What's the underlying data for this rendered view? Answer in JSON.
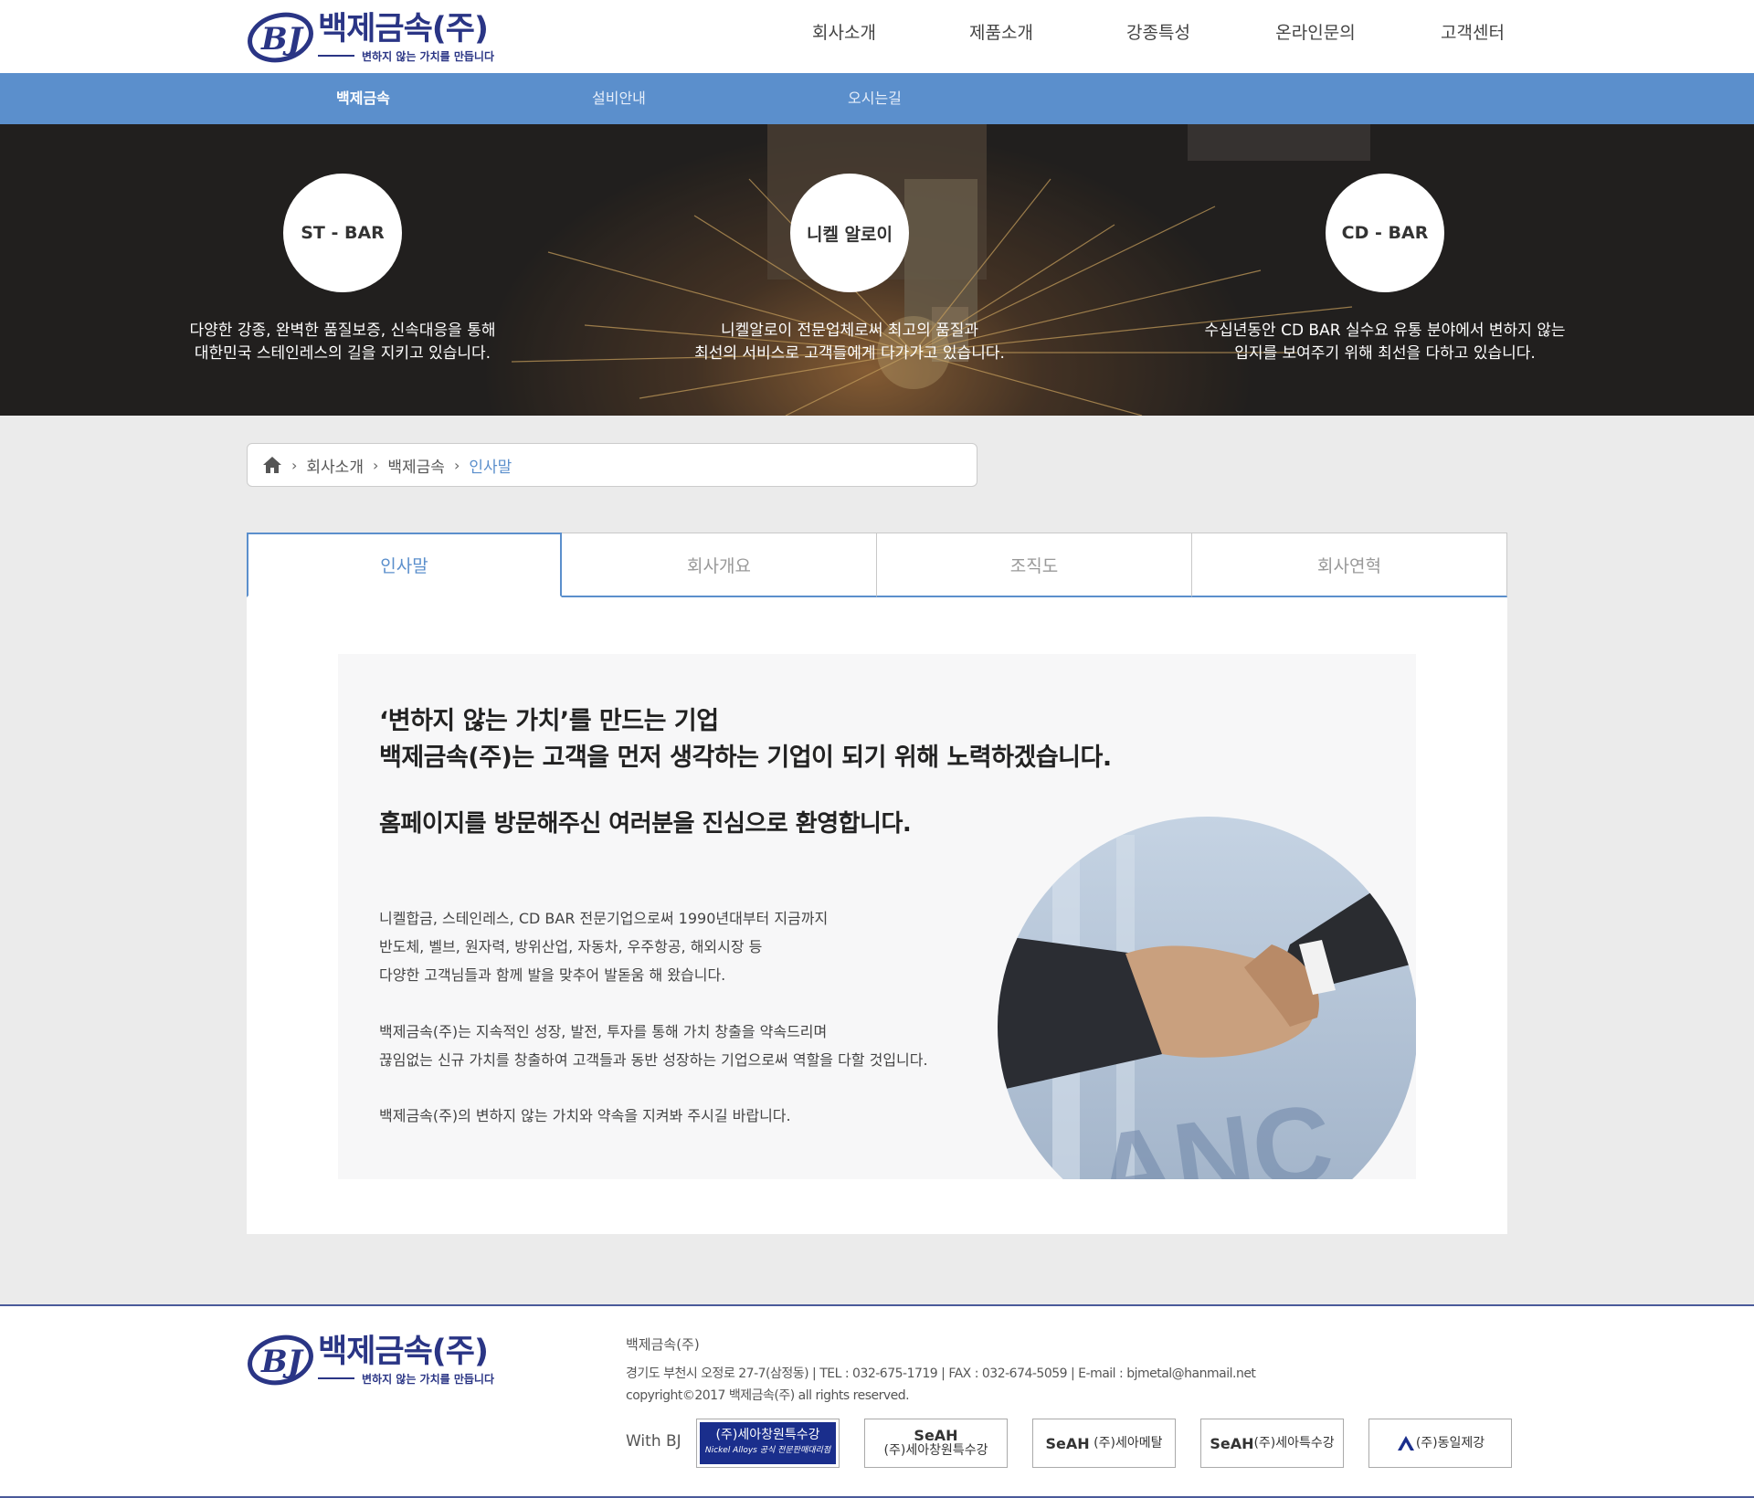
{
  "header": {
    "company_name": "백제금속(주)",
    "slogan": "변하지 않는 가치를 만듭니다",
    "nav": [
      "회사소개",
      "제품소개",
      "강종특성",
      "온라인문의",
      "고객센터"
    ]
  },
  "subnav": [
    "백제금속",
    "설비안내",
    "오시는길"
  ],
  "hero": [
    {
      "title": "ST - BAR",
      "line1": "다양한 강종, 완벽한 품질보증, 신속대응을 통해",
      "line2": "대한민국 스테인레스의 길을 지키고 있습니다."
    },
    {
      "title": "니켈 알로이",
      "line1": "니켈알로이 전문업체로써 최고의 품질과",
      "line2": "최선의 서비스로 고객들에게 다가가고 있습니다."
    },
    {
      "title": "CD - BAR",
      "line1": "수십년동안 CD BAR 실수요 유통 분야에서 변하지 않는",
      "line2": "입지를 보여주기 위해 최선을 다하고 있습니다."
    }
  ],
  "breadcrumb": {
    "items": [
      "회사소개",
      "백제금속"
    ],
    "current": "인사말"
  },
  "tabs": [
    "인사말",
    "회사개요",
    "조직도",
    "회사연혁"
  ],
  "greeting": {
    "headline1": "‘변하지 않는 가치’를 만드는 기업",
    "headline2": "백제금속(주)는 고객을 먼저 생각하는 기업이 되기 위해 노력하겠습니다.",
    "welcome": "홈페이지를 방문해주신 여러분을 진심으로 환영합니다.",
    "p1": [
      "니켈합금, 스테인레스, CD BAR 전문기업으로써 1990년대부터 지금까지",
      "반도체, 벨브, 원자력, 방위산업, 자동차, 우주항공, 해외시장 등",
      "다양한 고객님들과 함께 발을 맞추어 발돋움 해 왔습니다."
    ],
    "p2": [
      "백제금속(주)는 지속적인 성장, 발전, 투자를 통해 가치 창출을 약속드리며",
      "끊임없는 신규 가치를 창출하여 고객들과 동반 성장하는 기업으로써 역할을 다할 것입니다."
    ],
    "p3": "백제금속(주)의 변하지 않는 가치와 약속을 지켜봐 주시길 바랍니다."
  },
  "footer": {
    "company": "백제금속(주)",
    "address": "경기도 부천시 오정로 27-7(삼정동) | TEL : 032-675-1719 | FAX : 032-674-5059 | E-mail : bjmetal@hanmail.net",
    "copyright": "copyright©2017 백제금속(주) all rights reserved.",
    "with_label": "With BJ",
    "partners": [
      {
        "name": "(주)세아창원특수강",
        "sub": "Nickel Alloys 공식 전문판매대리점"
      },
      {
        "brand": "SeAH",
        "name": "(주)세아창원특수강"
      },
      {
        "brand": "SeAH",
        "name": "(주)세아메탈"
      },
      {
        "brand": "SeAH",
        "name": "(주)세아특수강"
      },
      {
        "name": "(주)동일제강"
      }
    ]
  },
  "colors": {
    "brand": "#2a3585",
    "accent": "#5b8fcc"
  }
}
